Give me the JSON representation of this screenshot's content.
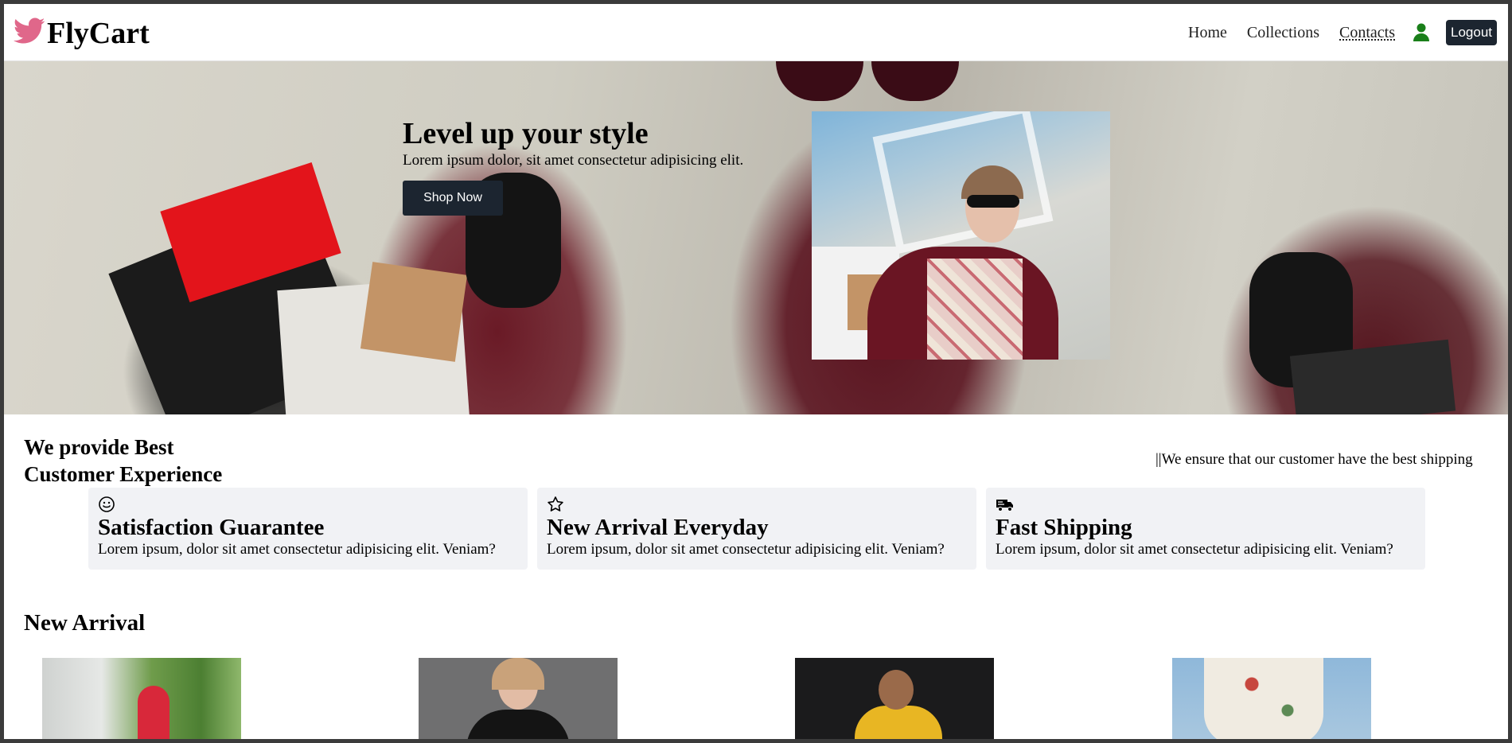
{
  "header": {
    "brand": "FlyCart",
    "nav": [
      {
        "label": "Home"
      },
      {
        "label": "Collections"
      },
      {
        "label": "Contacts"
      }
    ],
    "logout_label": "Logout",
    "icons": {
      "logo": "bird-icon",
      "user": "user-icon"
    },
    "colors": {
      "logo": "#e0678a",
      "user": "#1a7f1a",
      "button": "#1c2530"
    }
  },
  "hero": {
    "title": "Level up your style",
    "subtitle": "Lorem ipsum dolor, sit amet consectetur adipisicing elit.",
    "cta_label": "Shop Now"
  },
  "experience": {
    "title_line1": "We provide Best",
    "title_line2": "Customer Experience",
    "note": "||We ensure that our customer have the best shipping",
    "cards": [
      {
        "icon": "smile-icon",
        "title": "Satisfaction Guarantee",
        "desc": "Lorem ipsum, dolor sit amet consectetur adipisicing elit. Veniam?"
      },
      {
        "icon": "star-icon",
        "title": "New Arrival Everyday",
        "desc": "Lorem ipsum, dolor sit amet consectetur adipisicing elit. Veniam?"
      },
      {
        "icon": "truck-icon",
        "title": "Fast Shipping",
        "desc": "Lorem ipsum, dolor sit amet consectetur adipisicing elit. Veniam?"
      }
    ]
  },
  "new_arrival": {
    "title": "New Arrival"
  }
}
